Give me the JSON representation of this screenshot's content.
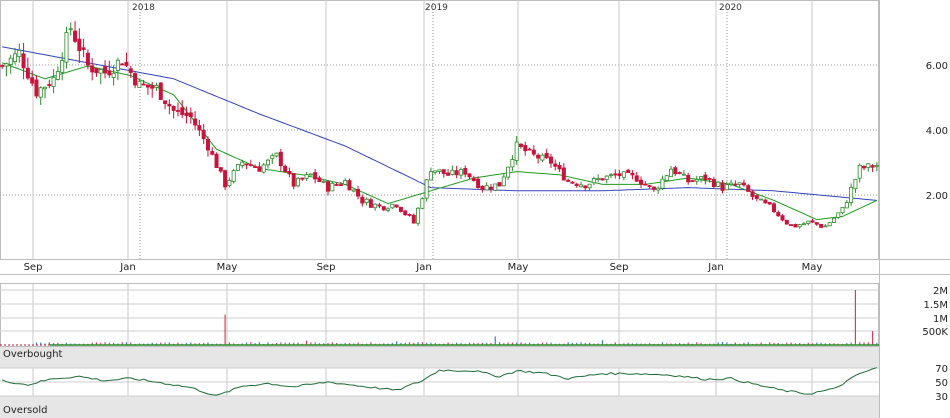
{
  "chart_data": [
    {
      "type": "candlestick",
      "price_axis": {
        "ticks": [
          "2.00",
          "4.00",
          "6.00"
        ],
        "ylim": [
          0,
          8
        ]
      },
      "year_labels": [
        "2018",
        "2019",
        "2020"
      ],
      "month_labels": [
        "Sep",
        "Jan",
        "May",
        "Sep",
        "Jan",
        "May",
        "Sep",
        "Jan",
        "May"
      ],
      "colors": {
        "up": "#2e8b2e",
        "down": "#c8143c",
        "sma_short": "#1e9b1e",
        "sma_long": "#3344bb",
        "grid": "#9a9a9a",
        "panel_border": "#bdbdbd"
      },
      "price_anchors": [
        [
          0,
          6.0
        ],
        [
          4,
          6.4
        ],
        [
          8,
          5.2
        ],
        [
          12,
          5.6
        ],
        [
          16,
          7.2
        ],
        [
          20,
          6.0
        ],
        [
          24,
          5.8
        ],
        [
          28,
          6.2
        ],
        [
          32,
          5.4
        ],
        [
          36,
          5.3
        ],
        [
          40,
          4.6
        ],
        [
          44,
          4.4
        ],
        [
          48,
          3.5
        ],
        [
          52,
          2.3
        ],
        [
          56,
          3.0
        ],
        [
          60,
          2.8
        ],
        [
          64,
          3.2
        ],
        [
          68,
          2.3
        ],
        [
          72,
          2.6
        ],
        [
          76,
          2.2
        ],
        [
          80,
          2.4
        ],
        [
          84,
          1.8
        ],
        [
          88,
          1.6
        ],
        [
          92,
          1.7
        ],
        [
          96,
          1.1
        ],
        [
          100,
          2.8
        ],
        [
          104,
          2.6
        ],
        [
          108,
          2.7
        ],
        [
          112,
          2.2
        ],
        [
          116,
          2.3
        ],
        [
          120,
          3.5
        ],
        [
          124,
          3.2
        ],
        [
          128,
          3.0
        ],
        [
          132,
          2.4
        ],
        [
          136,
          2.3
        ],
        [
          140,
          2.5
        ],
        [
          144,
          2.6
        ],
        [
          148,
          2.5
        ],
        [
          152,
          2.1
        ],
        [
          156,
          2.8
        ],
        [
          160,
          2.4
        ],
        [
          164,
          2.5
        ],
        [
          168,
          2.2
        ],
        [
          172,
          2.3
        ],
        [
          176,
          1.8
        ],
        [
          180,
          1.5
        ],
        [
          184,
          1.0
        ],
        [
          188,
          1.1
        ],
        [
          192,
          1.0
        ],
        [
          196,
          1.5
        ],
        [
          200,
          2.8
        ],
        [
          204,
          2.9
        ]
      ],
      "sma_short_anchors": [
        [
          0,
          6.1
        ],
        [
          10,
          5.6
        ],
        [
          20,
          6.0
        ],
        [
          30,
          5.7
        ],
        [
          40,
          5.1
        ],
        [
          50,
          3.4
        ],
        [
          60,
          2.8
        ],
        [
          70,
          2.6
        ],
        [
          80,
          2.3
        ],
        [
          90,
          1.7
        ],
        [
          100,
          2.1
        ],
        [
          110,
          2.5
        ],
        [
          120,
          2.7
        ],
        [
          130,
          2.6
        ],
        [
          140,
          2.3
        ],
        [
          150,
          2.3
        ],
        [
          160,
          2.5
        ],
        [
          170,
          2.3
        ],
        [
          180,
          1.8
        ],
        [
          190,
          1.2
        ],
        [
          196,
          1.3
        ],
        [
          204,
          1.8
        ]
      ],
      "sma_long_anchors": [
        [
          0,
          6.6
        ],
        [
          20,
          6.1
        ],
        [
          40,
          5.6
        ],
        [
          60,
          4.5
        ],
        [
          80,
          3.5
        ],
        [
          100,
          2.2
        ],
        [
          120,
          2.1
        ],
        [
          140,
          2.1
        ],
        [
          160,
          2.2
        ],
        [
          180,
          2.1
        ],
        [
          204,
          1.8
        ]
      ],
      "volume_axis": {
        "ticks": [
          "500K",
          "1M",
          "1.5M",
          "2M"
        ]
      },
      "volume_spikes": [
        [
          52,
          1.1
        ],
        [
          71,
          0.15
        ],
        [
          92,
          0.12
        ],
        [
          115,
          0.3
        ],
        [
          140,
          0.16
        ],
        [
          168,
          0.1
        ],
        [
          199,
          2.0
        ],
        [
          203,
          0.5
        ]
      ],
      "oscillator": {
        "levels": [
          "30",
          "50",
          "70"
        ],
        "overbought_label": "Overbought",
        "oversold_label": "Oversold",
        "anchors": [
          [
            0,
            52
          ],
          [
            6,
            46
          ],
          [
            12,
            55
          ],
          [
            18,
            58
          ],
          [
            24,
            52
          ],
          [
            30,
            55
          ],
          [
            36,
            50
          ],
          [
            44,
            42
          ],
          [
            50,
            30
          ],
          [
            56,
            44
          ],
          [
            62,
            48
          ],
          [
            68,
            43
          ],
          [
            76,
            50
          ],
          [
            84,
            44
          ],
          [
            92,
            38
          ],
          [
            98,
            52
          ],
          [
            102,
            67
          ],
          [
            110,
            66
          ],
          [
            116,
            58
          ],
          [
            120,
            66
          ],
          [
            126,
            63
          ],
          [
            132,
            55
          ],
          [
            140,
            62
          ],
          [
            148,
            62
          ],
          [
            156,
            60
          ],
          [
            164,
            54
          ],
          [
            170,
            55
          ],
          [
            176,
            46
          ],
          [
            182,
            38
          ],
          [
            188,
            33
          ],
          [
            194,
            40
          ],
          [
            200,
            62
          ],
          [
            204,
            70
          ]
        ]
      }
    }
  ]
}
